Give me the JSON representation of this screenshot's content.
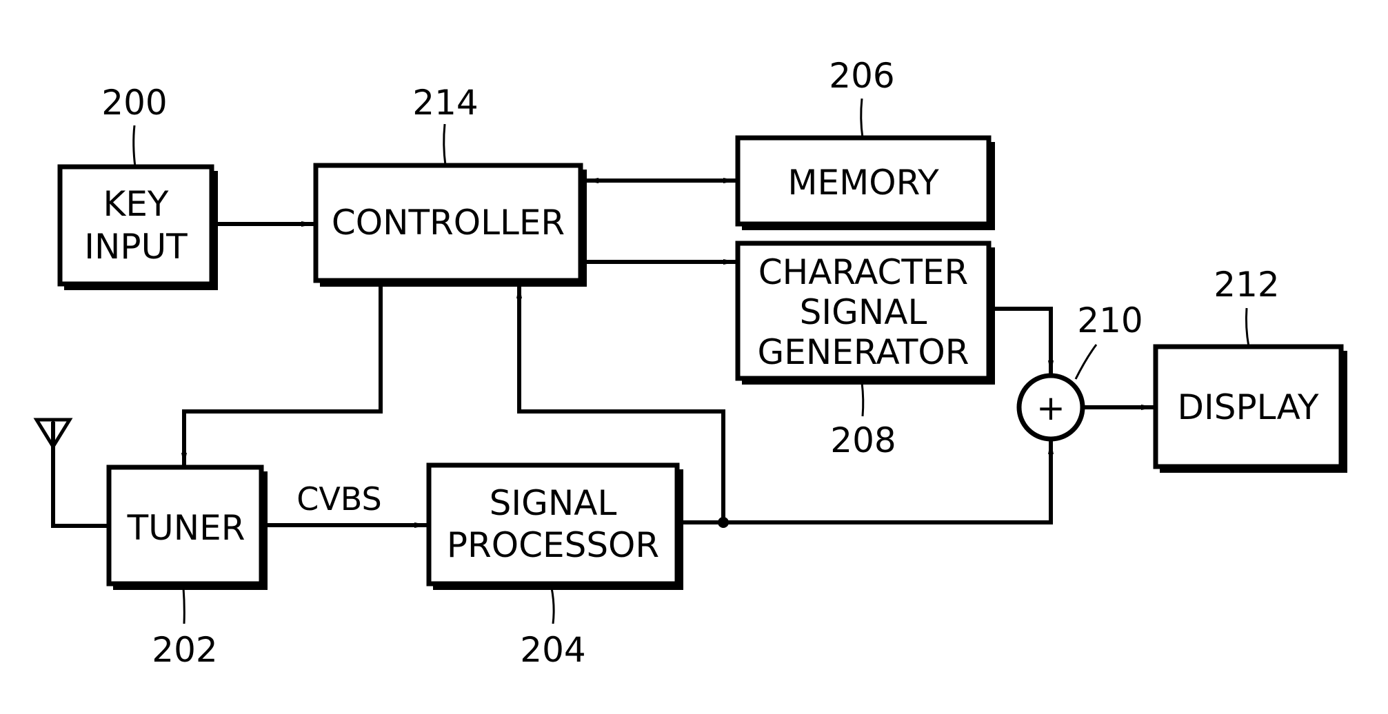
{
  "figure": {
    "type": "block-diagram",
    "color_ink": "#000000",
    "color_background": "#ffffff"
  },
  "blocks": {
    "key_input": {
      "label_lines": [
        "KEY",
        "INPUT"
      ],
      "ref": "200"
    },
    "controller": {
      "label_lines": [
        "CONTROLLER"
      ],
      "ref": "214"
    },
    "memory": {
      "label_lines": [
        "MEMORY"
      ],
      "ref": "206"
    },
    "character_generator": {
      "label_lines": [
        "CHARACTER",
        "SIGNAL",
        "GENERATOR"
      ],
      "ref": "208"
    },
    "adder": {
      "symbol": "+",
      "ref": "210"
    },
    "display": {
      "label_lines": [
        "DISPLAY"
      ],
      "ref": "212"
    },
    "tuner": {
      "label_lines": [
        "TUNER"
      ],
      "ref": "202"
    },
    "signal_processor": {
      "label_lines": [
        "SIGNAL",
        "PROCESSOR"
      ],
      "ref": "204"
    }
  },
  "signals": {
    "tuner_to_processor": "CVBS"
  },
  "connections": [
    {
      "from": "key_input",
      "to": "controller",
      "direction": "one-way"
    },
    {
      "from": "controller",
      "to": "memory",
      "direction": "two-way"
    },
    {
      "from": "controller",
      "to": "character_generator",
      "direction": "one-way"
    },
    {
      "from": "controller",
      "to": "tuner",
      "direction": "one-way"
    },
    {
      "from": "antenna",
      "to": "tuner",
      "direction": "one-way"
    },
    {
      "from": "tuner",
      "to": "signal_processor",
      "direction": "one-way",
      "label": "CVBS"
    },
    {
      "from": "signal_processor",
      "to": "controller",
      "direction": "one-way"
    },
    {
      "from": "signal_processor",
      "to": "adder",
      "direction": "one-way"
    },
    {
      "from": "character_generator",
      "to": "adder",
      "direction": "one-way"
    },
    {
      "from": "adder",
      "to": "display",
      "direction": "one-way"
    }
  ],
  "icons": {
    "antenna": "antenna-icon",
    "adder": "summing-junction-icon"
  }
}
